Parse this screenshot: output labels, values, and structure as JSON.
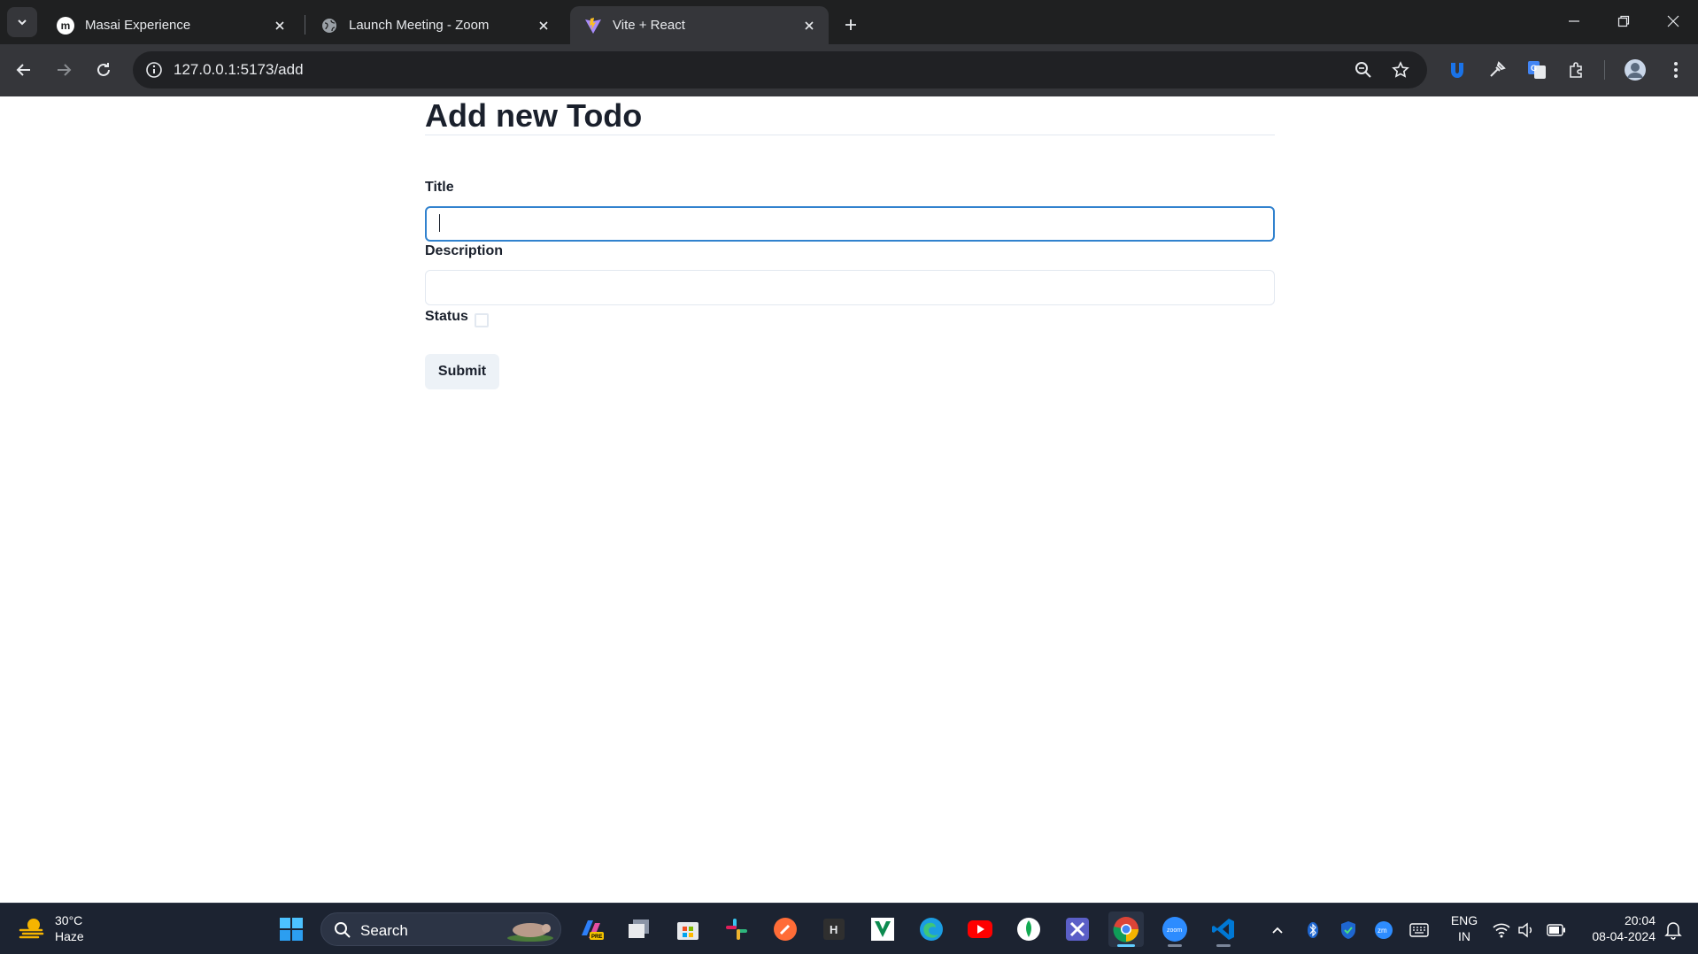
{
  "browser": {
    "tabs": [
      {
        "title": "Masai Experience",
        "favicon": "masai-logo-icon",
        "active": false
      },
      {
        "title": "Launch Meeting - Zoom",
        "favicon": "globe-icon",
        "active": false
      },
      {
        "title": "Vite + React",
        "favicon": "vite-logo-icon",
        "active": true
      }
    ],
    "url": "127.0.0.1:5173/add"
  },
  "page": {
    "heading": "Add new Todo",
    "form": {
      "title_label": "Title",
      "title_value": "",
      "description_label": "Description",
      "description_value": "",
      "status_label": "Status",
      "status_checked": false,
      "submit_label": "Submit"
    }
  },
  "taskbar": {
    "weather": {
      "temp": "30°C",
      "condition": "Haze"
    },
    "search_placeholder": "Search",
    "language": {
      "line1": "ENG",
      "line2": "IN"
    },
    "clock": {
      "time": "20:04",
      "date": "08-04-2024"
    }
  },
  "colors": {
    "focus_ring": "#3182ce",
    "chrome_dark": "#35363a",
    "taskbar_bg": "#1c2331"
  }
}
